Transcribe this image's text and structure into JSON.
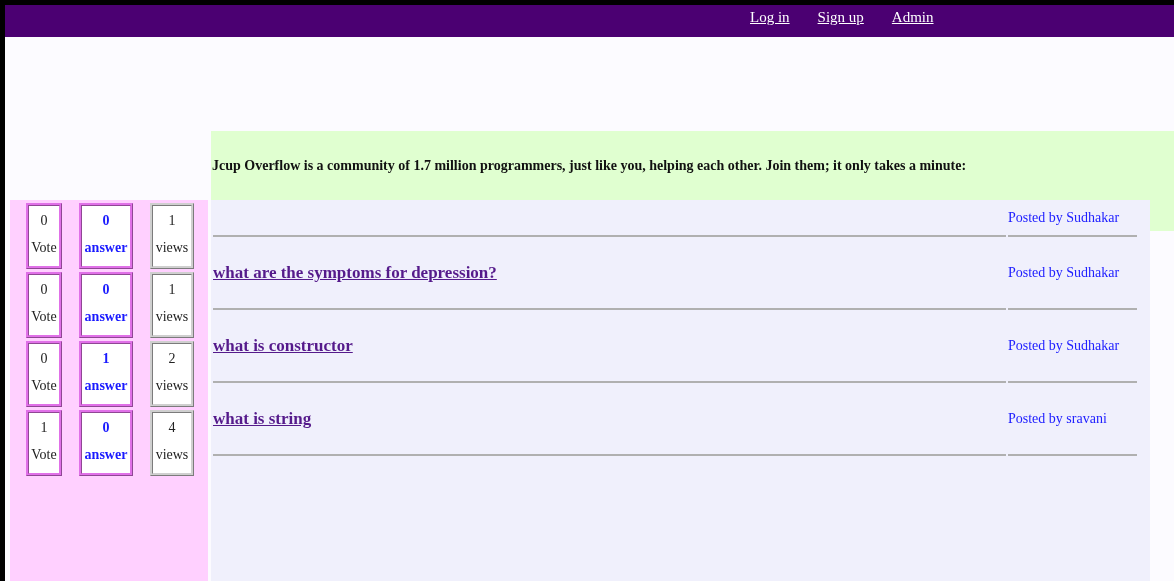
{
  "nav": {
    "links": [
      "Log in",
      "Sign up",
      "Admin"
    ]
  },
  "banner": {
    "text": "Jcup Overflow is a community of 1.7 million programmers, just like you, helping each other. Join them; it only takes a minute:"
  },
  "stats": [
    {
      "votes": "0",
      "votes_label": "Vote",
      "answers": "0",
      "answers_label": "answer",
      "views": "1",
      "views_label": "views"
    },
    {
      "votes": "0",
      "votes_label": "Vote",
      "answers": "0",
      "answers_label": "answer",
      "views": "1",
      "views_label": "views"
    },
    {
      "votes": "0",
      "votes_label": "Vote",
      "answers": "1",
      "answers_label": "answer",
      "views": "2",
      "views_label": "views"
    },
    {
      "votes": "1",
      "votes_label": "Vote",
      "answers": "0",
      "answers_label": "answer",
      "views": "4",
      "views_label": "views"
    }
  ],
  "questions": [
    {
      "posted_by": "Posted by Sudhakar"
    },
    {
      "title": "what are the symptoms for depression?",
      "posted_by": "Posted by Sudhakar"
    },
    {
      "title": "what is constructor",
      "posted_by": "Posted by Sudhakar"
    },
    {
      "title": "what is string",
      "posted_by": "Posted by sravani"
    }
  ]
}
